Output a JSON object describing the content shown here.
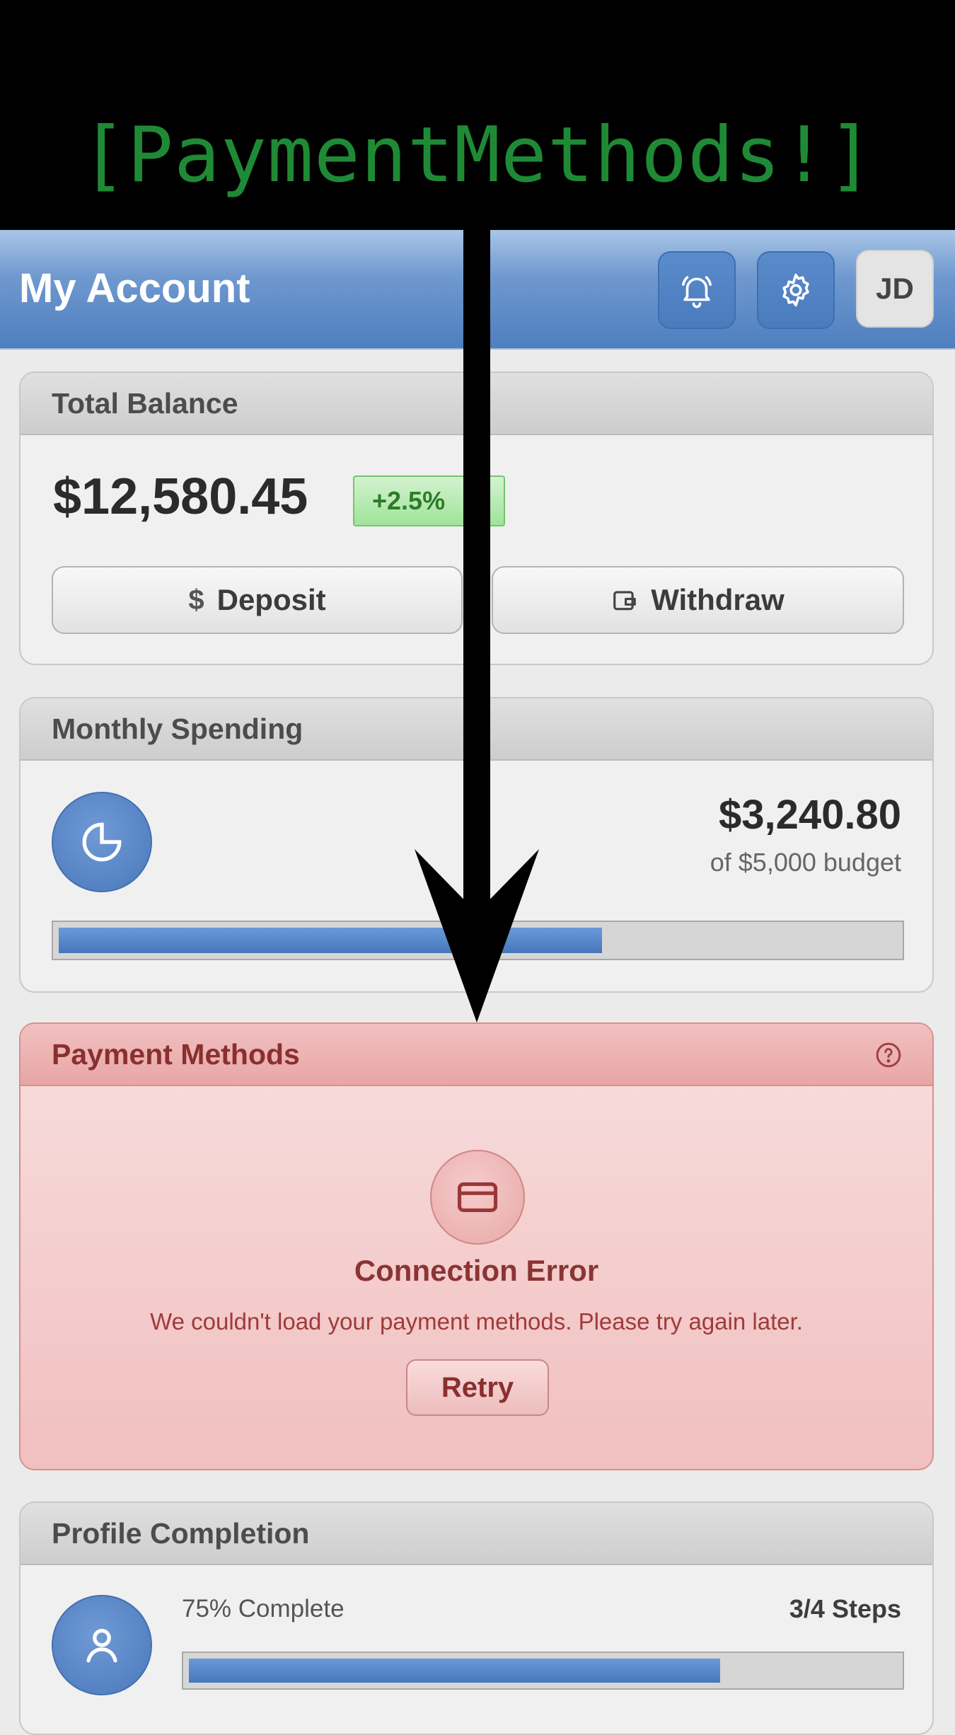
{
  "banner": {
    "text": "[PaymentMethods!]"
  },
  "header": {
    "title": "My Account",
    "notifications_icon": "bell-icon",
    "settings_icon": "gear-icon",
    "avatar_initials": "JD"
  },
  "balance_card": {
    "title": "Total Balance",
    "amount": "$12,580.45",
    "change": "+2.5%",
    "deposit_label": "Deposit",
    "withdraw_label": "Withdraw"
  },
  "spending_card": {
    "title": "Monthly Spending",
    "amount": "$3,240.80",
    "budget_text": "of $5,000 budget",
    "progress_fraction": 0.648
  },
  "payment_card": {
    "title": "Payment Methods",
    "error_title": "Connection Error",
    "error_message": "We couldn't load your payment methods. Please try again later.",
    "retry_label": "Retry"
  },
  "profile_card": {
    "title": "Profile Completion",
    "percent_text": "75% Complete",
    "steps_text": "3/4 Steps",
    "progress_fraction": 0.75
  },
  "colors": {
    "accent": "#4a7cbd",
    "error": "#8a2f2f",
    "success": "#2e7b2a",
    "banner_text": "#1f8a36"
  }
}
